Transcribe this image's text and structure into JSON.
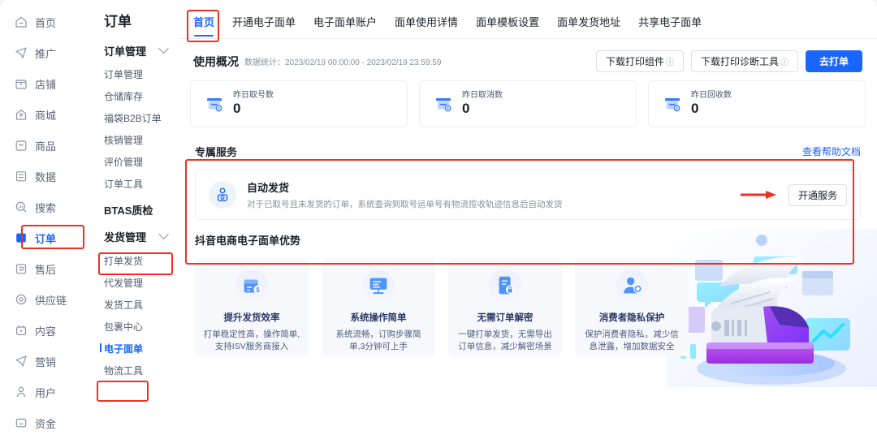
{
  "sidebar_primary": {
    "items": [
      {
        "label": "首页",
        "icon": "home-icon",
        "active": false
      },
      {
        "label": "推广",
        "icon": "promotion-icon",
        "active": false
      },
      {
        "label": "店铺",
        "icon": "shop-icon",
        "active": false
      },
      {
        "label": "商城",
        "icon": "mall-icon",
        "active": false
      },
      {
        "label": "商品",
        "icon": "product-icon",
        "active": false
      },
      {
        "label": "数据",
        "icon": "data-icon",
        "active": false
      },
      {
        "label": "搜索",
        "icon": "search-icon",
        "active": false
      },
      {
        "label": "订单",
        "icon": "order-icon",
        "active": true
      },
      {
        "label": "售后",
        "icon": "aftersale-icon",
        "active": false
      },
      {
        "label": "供应链",
        "icon": "supplychain-icon",
        "active": false
      },
      {
        "label": "内容",
        "icon": "content-icon",
        "active": false
      },
      {
        "label": "营销",
        "icon": "marketing-icon",
        "active": false
      },
      {
        "label": "用户",
        "icon": "user-icon",
        "active": false
      },
      {
        "label": "资金",
        "icon": "fund-icon",
        "active": false
      }
    ]
  },
  "sidebar_secondary": {
    "title": "订单",
    "group_order": {
      "label": "订单管理",
      "icon": "chevron-down-icon"
    },
    "order_items": [
      "订单管理",
      "仓储库存",
      "福袋B2B订单",
      "核销管理",
      "评价管理",
      "订单工具"
    ],
    "btas": "BTAS质检",
    "group_ship": {
      "label": "发货管理",
      "icon": "chevron-down-icon"
    },
    "ship_items": [
      "打单发货",
      "代发管理",
      "发货工具",
      "包裹中心"
    ],
    "current_item": "电子面单",
    "trailing_items": [
      "物流工具"
    ]
  },
  "tabs": [
    {
      "label": "首页",
      "active": true
    },
    {
      "label": "开通电子面单",
      "active": false
    },
    {
      "label": "电子面单账户",
      "active": false
    },
    {
      "label": "面单使用详情",
      "active": false
    },
    {
      "label": "面单模板设置",
      "active": false
    },
    {
      "label": "面单发货地址",
      "active": false
    },
    {
      "label": "共享电子面单",
      "active": false
    }
  ],
  "usage": {
    "title": "使用概况",
    "range_label": "数据统计：",
    "range_value": "2023/02/19 00:00:00 - 2023/02/19 23:59:59",
    "buttons": [
      {
        "label": "下载打印组件",
        "hint": "?",
        "primary": false
      },
      {
        "label": "下载打印诊断工具",
        "hint": "?",
        "primary": false
      },
      {
        "label": "去打单",
        "hint": "",
        "primary": true
      }
    ],
    "stats": [
      {
        "label": "昨日取号数",
        "value": "0",
        "icon": "waybill-icon"
      },
      {
        "label": "昨日取消数",
        "value": "0",
        "icon": "waybill-icon"
      },
      {
        "label": "昨日回收数",
        "value": "0",
        "icon": "waybill-icon"
      }
    ]
  },
  "service": {
    "title": "专属服务",
    "help_link": "查看帮助文档",
    "item": {
      "name": "自动发货",
      "desc": "对于已取号且未发货的订单，系统查询到取号运单号有物流揽收轨迹信息后自动发货",
      "icon": "auto-ship-icon",
      "button": "开通服务"
    }
  },
  "advantages": {
    "title": "抖音电商电子面单优势",
    "cards": [
      {
        "icon": "package-money-icon",
        "heading": "提升发货效率",
        "text": "打单稳定性高，操作简单,支持ISV服务商接入"
      },
      {
        "icon": "monitor-icon",
        "heading": "系统操作简单",
        "text": "系统流畅，订购步骤简单,3分钟可上手"
      },
      {
        "icon": "secure-doc-icon",
        "heading": "无需订单解密",
        "text": "一键打单发货，无需导出订单信息，减少解密场景"
      },
      {
        "icon": "privacy-user-icon",
        "heading": "消费者隐私保护",
        "text": "保护消费者隐私，减少信息泄露，增加数据安全"
      }
    ],
    "illustration": "printer-illustration"
  },
  "colors": {
    "accent": "#1966ff",
    "annotation": "#ef3124",
    "text_primary": "#1d2129",
    "text_secondary": "#86909c"
  }
}
